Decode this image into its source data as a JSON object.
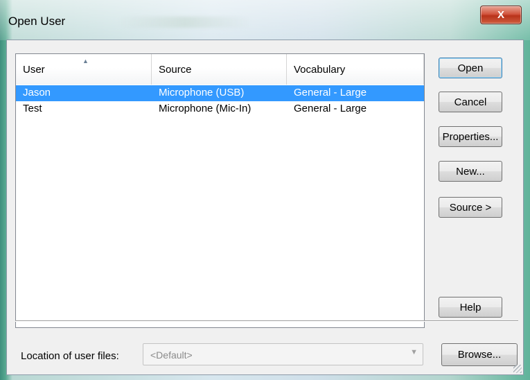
{
  "window": {
    "title": "Open User",
    "close_label": "X"
  },
  "list": {
    "columns": [
      "User",
      "Source",
      "Vocabulary"
    ],
    "rows": [
      {
        "user": "Jason",
        "source": "Microphone (USB)",
        "vocabulary": "General - Large",
        "selected": true
      },
      {
        "user": "Test",
        "source": "Microphone (Mic-In)",
        "vocabulary": "General - Large",
        "selected": false
      }
    ]
  },
  "buttons": {
    "open": "Open",
    "cancel": "Cancel",
    "properties": "Properties...",
    "new": "New...",
    "source": "Source >",
    "help": "Help",
    "browse": "Browse..."
  },
  "location": {
    "label": "Location of user files:",
    "value": "<Default>"
  },
  "colors": {
    "selection": "#3399ff",
    "close_button": "#c94a32"
  }
}
